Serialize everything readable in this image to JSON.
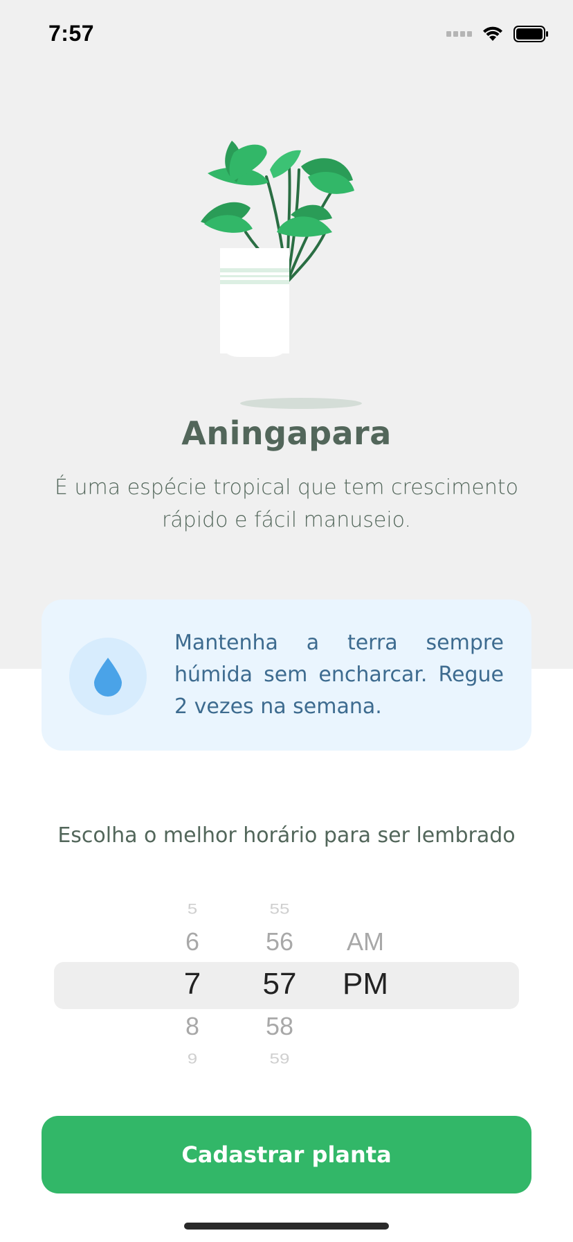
{
  "status_bar": {
    "time": "7:57",
    "icons": [
      "signal-icon",
      "wifi-icon",
      "battery-icon"
    ]
  },
  "plant": {
    "name": "Aningapara",
    "about": "É uma espécie tropical que tem crescimento rápido e fácil manuseio.",
    "illustration": "potted-plant-illustration"
  },
  "tip": {
    "icon": "water-drop-icon",
    "text": "Mantenha a terra sempre húmida sem encharcar. Regue 2 vezes na semana."
  },
  "alert": {
    "label": "Escolha o melhor horário para ser lembrado"
  },
  "time_picker": {
    "hours": [
      "5",
      "6",
      "7",
      "8",
      "9"
    ],
    "minutes": [
      "55",
      "56",
      "57",
      "58",
      "59"
    ],
    "periods": [
      "",
      "AM",
      "PM",
      "",
      ""
    ],
    "selected": {
      "hour": "7",
      "minute": "57",
      "period": "PM"
    }
  },
  "actions": {
    "register_label": "Cadastrar planta"
  },
  "colors": {
    "accent_green": "#32b768",
    "heading": "#52665a",
    "tip_bg": "#eaf5fe",
    "tip_text": "#3d6b8f",
    "drop_blue": "#4aa3e8",
    "top_bg": "#f0f0f0"
  }
}
